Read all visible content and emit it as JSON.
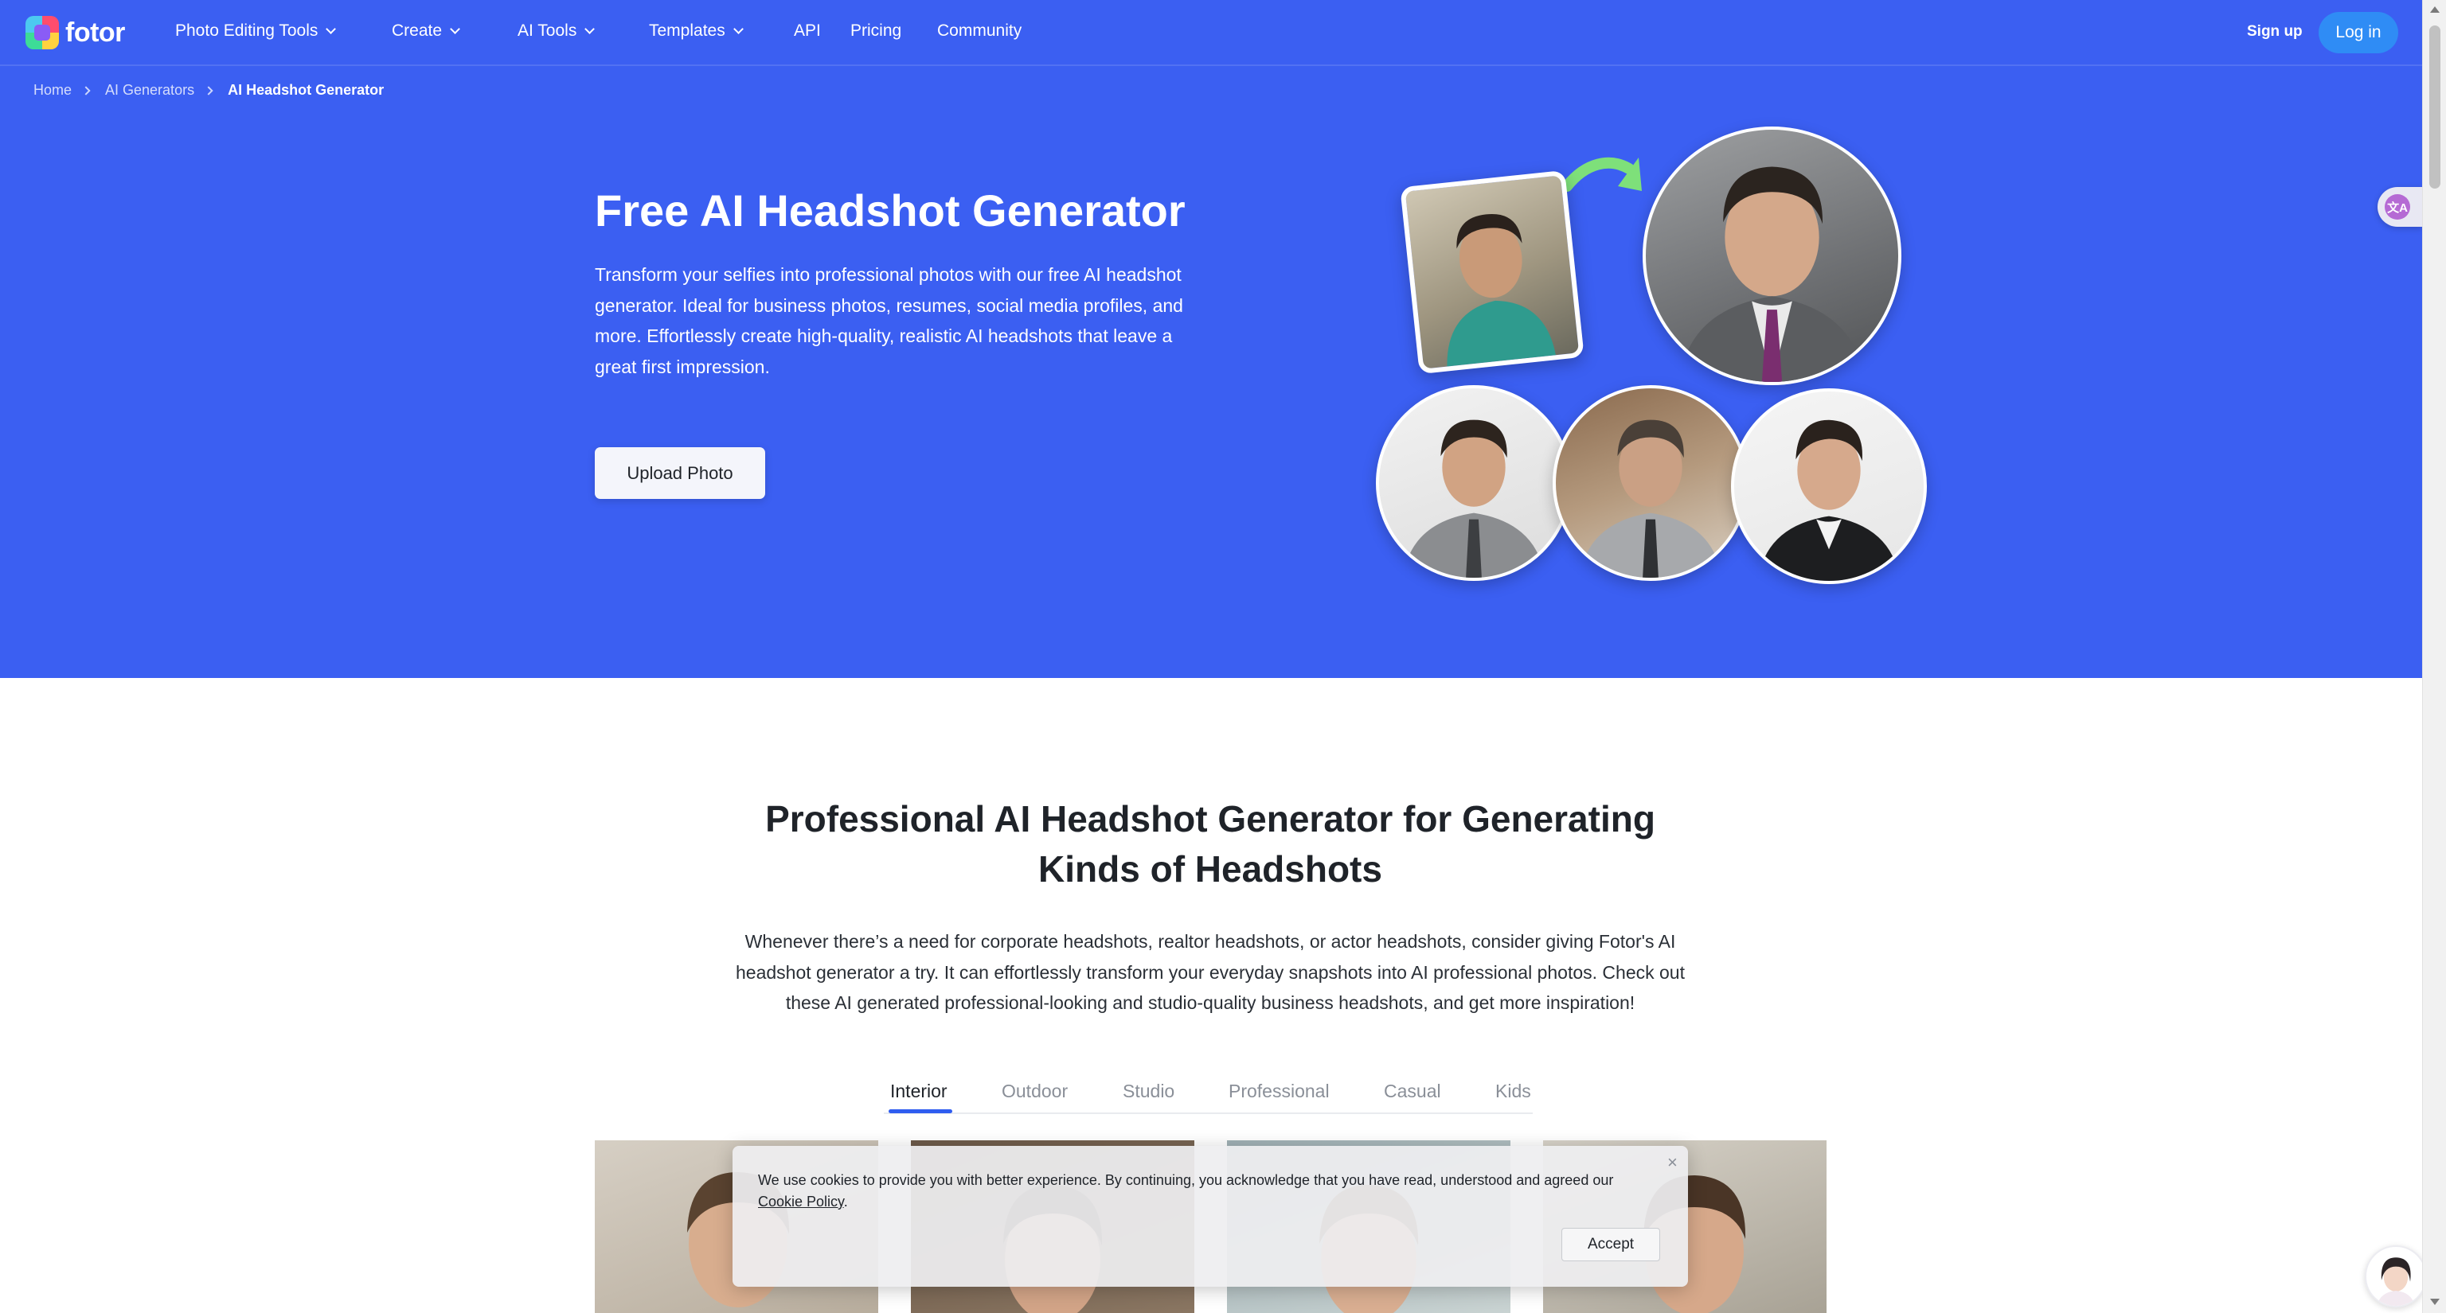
{
  "brand": {
    "name": "fotor"
  },
  "nav": {
    "items": [
      {
        "label": "Photo Editing Tools",
        "dropdown": true
      },
      {
        "label": "Create",
        "dropdown": true
      },
      {
        "label": "AI Tools",
        "dropdown": true
      },
      {
        "label": "Templates",
        "dropdown": true
      },
      {
        "label": "API",
        "dropdown": false
      },
      {
        "label": "Pricing",
        "dropdown": false
      },
      {
        "label": "Community",
        "dropdown": false
      }
    ],
    "signup": "Sign up",
    "login": "Log in"
  },
  "breadcrumb": [
    "Home",
    "AI Generators",
    "AI Headshot Generator"
  ],
  "hero": {
    "title": "Free AI Headshot Generator",
    "description": "Transform your selfies into professional photos with our free AI headshot generator. Ideal for business photos, resumes, social media profiles, and more. Effortlessly create high-quality, realistic AI headshots that leave a great first impression.",
    "cta": "Upload Photo"
  },
  "section": {
    "title": "Professional AI Headshot Generator for Generating Kinds of Headshots",
    "description": "Whenever there’s a need for corporate headshots, realtor headshots, or actor headshots, consider giving Fotor's AI headshot generator a try. It can effortlessly transform your everyday snapshots into AI professional photos. Check out these AI generated professional-looking and studio-quality business headshots, and get more inspiration!",
    "tabs": [
      "Interior",
      "Outdoor",
      "Studio",
      "Professional",
      "Casual",
      "Kids"
    ],
    "active_tab": "Interior"
  },
  "cookie": {
    "text": "We use cookies to provide you with better experience. By continuing, you acknowledge that you have read, understood and agreed our ",
    "link": "Cookie Policy",
    "suffix": ".",
    "close": "×",
    "accept": "Accept"
  },
  "translate_widget": {
    "glyph": "文A"
  },
  "colors": {
    "hero_bg": "#3b5ff2",
    "login_bg": "#2f8cf5",
    "tab_accent": "#2f5df0",
    "arrow": "#7ee07a"
  }
}
